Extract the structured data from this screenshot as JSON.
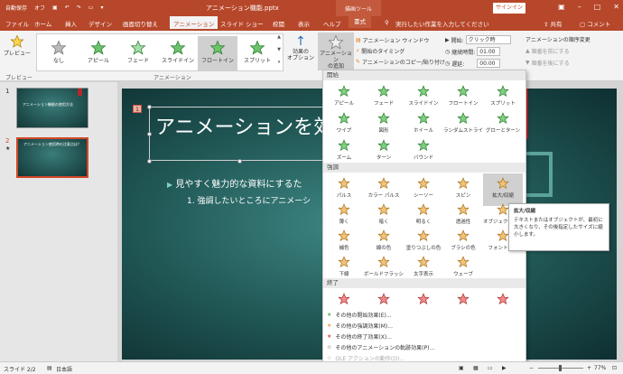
{
  "titlebar": {
    "autosave_label": "自動保存",
    "autosave_state": "オフ",
    "document_title": "アニメーション機能.pptx",
    "context_tools": "描画ツール",
    "signin": "サインイン"
  },
  "tabs": [
    "ファイル",
    "ホーム",
    "挿入",
    "デザイン",
    "画面切り替え",
    "アニメーション",
    "スライド ショー",
    "校閲",
    "表示",
    "ヘルプ",
    "書式"
  ],
  "active_tab": "アニメーション",
  "search_placeholder": "実行したい作業を入力してください",
  "share_label": "共有",
  "comment_label": "コメント",
  "ribbon": {
    "preview_label": "プレビュー",
    "preview_group": "プレビュー",
    "animation_group": "アニメーション",
    "gallery": [
      "なし",
      "アピール",
      "フェード",
      "スライドイン",
      "フロートイン",
      "スプリット"
    ],
    "effect_options": "効果の\nオプション",
    "add_animation": "アニメーション\nの追加",
    "animation_window": "アニメーション ウィンドウ",
    "trigger": "開始のタイミング",
    "painter": "アニメーションのコピー/貼り付け",
    "start_label": "開始:",
    "start_value": "クリック時",
    "duration_label": "継続時間:",
    "duration_value": "01.00",
    "delay_label": "遅延:",
    "delay_value": "00.00",
    "order_label": "アニメーションの順序変更",
    "move_earlier": "順番を前にする",
    "move_later": "順番を後にする"
  },
  "slides": [
    {
      "num": "1",
      "title": "アニメーション機能の使用方法"
    },
    {
      "num": "2",
      "title": "アニメーション使用時の注意点は？",
      "star": "★"
    }
  ],
  "slide": {
    "anim_tag": "1",
    "title": "アニメーションを効",
    "bullet1": "見やすく魅力的な資料にするた",
    "bullet2_num": "1.",
    "bullet2": "強調したいところにアニメーシ"
  },
  "dropdown": {
    "sections": {
      "entrance": "開始",
      "emphasis": "強調",
      "exit": "終了"
    },
    "entrance": [
      "アピール",
      "フェード",
      "スライドイン",
      "フロートイン",
      "スプリット",
      "ワイプ",
      "図形",
      "ホイール",
      "ランダムストライプ",
      "グローとターン",
      "ズーム",
      "ターン",
      "バウンド"
    ],
    "emphasis": [
      "パルス",
      "カラー パルス",
      "シーソー",
      "スピン",
      "拡大/収縮",
      "薄く",
      "暗く",
      "明るく",
      "透過性",
      "オブジェクトカラー",
      "補色",
      "線の色",
      "塗りつぶしの色",
      "ブラシの色",
      "フォントの色",
      "下線",
      "ボールドフラッシュ",
      "太字表示",
      "ウェーブ"
    ],
    "more": [
      "その他の開始効果(E)...",
      "その他の強調効果(M)...",
      "その他の終了効果(X)...",
      "その他のアニメーションの軌跡効果(P)...",
      "OLE アクションの動作(O)..."
    ],
    "colors": {
      "entrance": "#5cb85c",
      "emphasis": "#e9a43c",
      "exit": "#d9534f"
    }
  },
  "tooltip": {
    "title": "拡大/収縮",
    "body": "テキストまたはオブジェクトが、最初に大きくなり、その後指定したサイズに縮小します。"
  },
  "statusbar": {
    "slide": "スライド 2/2",
    "language": "日本語",
    "zoom": "77%"
  }
}
